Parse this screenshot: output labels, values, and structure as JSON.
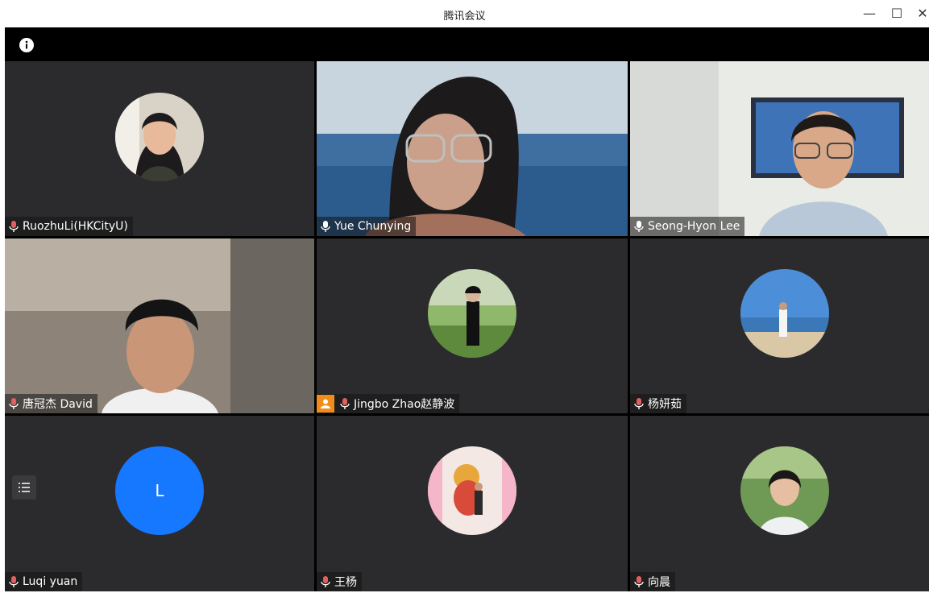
{
  "window": {
    "title": "腾讯会议",
    "minimize": "—",
    "maximize": "☐",
    "close": "✕"
  },
  "colors": {
    "tile_bg": "#2b2b2d",
    "stage_bg": "#000000",
    "avatar_blue": "#1677ff",
    "host_badge": "#f08c1a"
  },
  "participants": [
    {
      "name": "RuozhuLi(HKCityU)",
      "mode": "avatar"
    },
    {
      "name": "Yue Chunying",
      "mode": "video"
    },
    {
      "name": "Seong-Hyon Lee",
      "mode": "video"
    },
    {
      "name": "唐冠杰 David",
      "mode": "video"
    },
    {
      "name": "Jingbo Zhao赵静波",
      "mode": "avatar",
      "host": true
    },
    {
      "name": "杨妍茹",
      "mode": "avatar"
    },
    {
      "name": "Luqi yuan",
      "mode": "letter",
      "letter": "L"
    },
    {
      "name": "王杨",
      "mode": "avatar"
    },
    {
      "name": "向晨",
      "mode": "avatar"
    }
  ]
}
